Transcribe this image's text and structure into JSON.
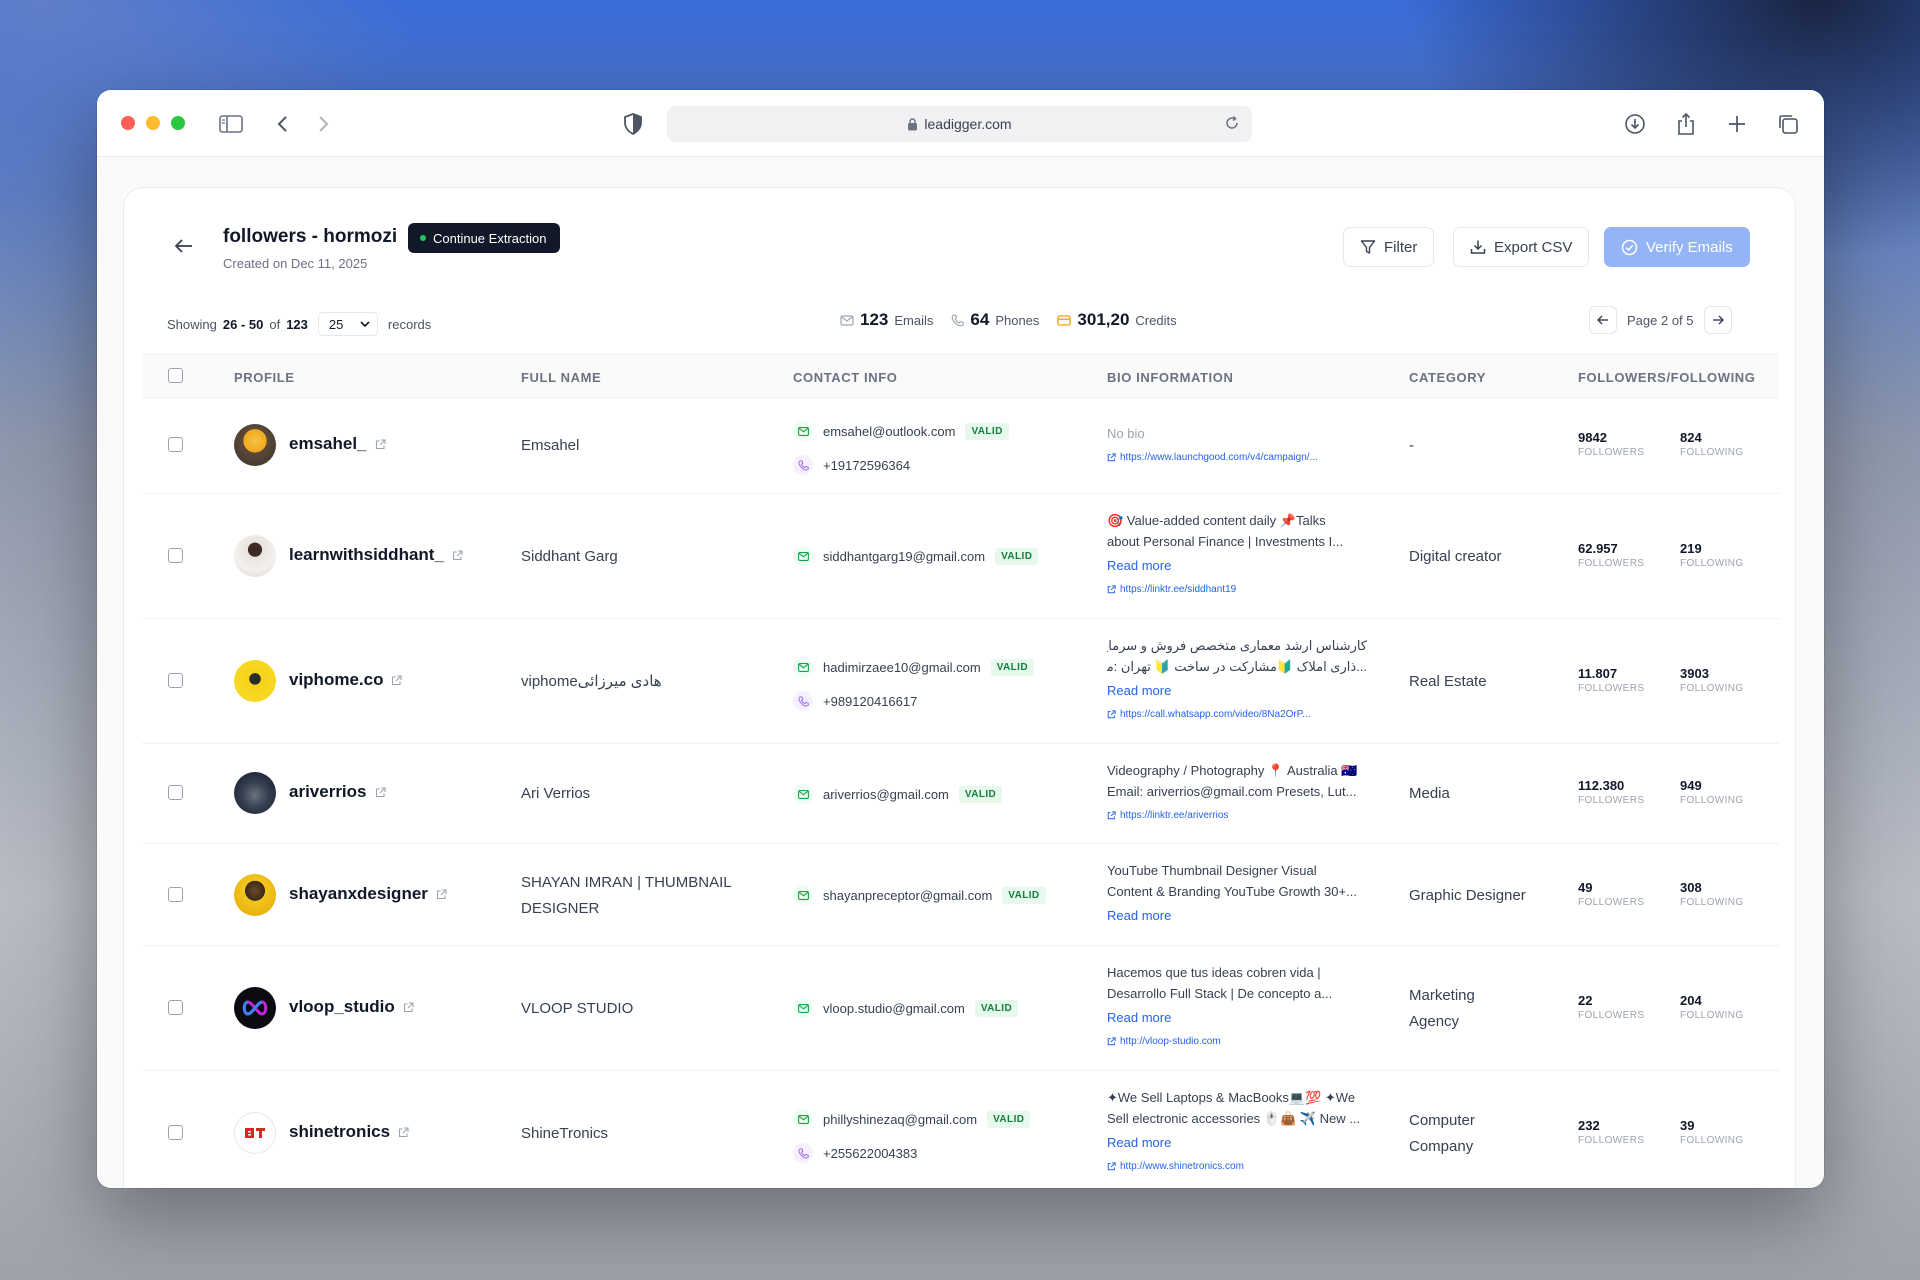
{
  "browser": {
    "url": "leadigger.com"
  },
  "header": {
    "title": "followers - hormozi",
    "continue_label": "Continue Extraction",
    "created": "Created on Dec 11, 2025",
    "filter_label": "Filter",
    "export_label": "Export CSV",
    "verify_label": "Verify Emails"
  },
  "toolbar": {
    "showing_prefix": "Showing",
    "range": "26 - 50",
    "of_label": "of",
    "total": "123",
    "per_page": "25",
    "records_label": "records",
    "emails_count": "123",
    "emails_label": "Emails",
    "phones_count": "64",
    "phones_label": "Phones",
    "credits_count": "301,20",
    "credits_label": "Credits",
    "page_label": "Page 2 of 5"
  },
  "columns": {
    "profile": "PROFILE",
    "full_name": "FULL NAME",
    "contact": "CONTACT INFO",
    "bio": "BIO INFORMATION",
    "category": "CATEGORY",
    "ff": "FOLLOWERS/FOLLOWING"
  },
  "labels": {
    "valid": "VALID",
    "followers": "FOLLOWERS",
    "following": "FOLLOWING",
    "read_more": "Read more",
    "no_bio": "No bio"
  },
  "rows": [
    {
      "username": "emsahel_",
      "full_name": "Emsahel",
      "email": "emsahel@outlook.com",
      "phone": "+19172596364",
      "bio1": "No bio",
      "bio2": "",
      "bio_link": "https://www.launchgood.com/v4/campaign/...",
      "category": "-",
      "category2": "",
      "followers": "9842",
      "following": "824"
    },
    {
      "username": "learnwithsiddhant_",
      "full_name": "Siddhant Garg",
      "email": "siddhantgarg19@gmail.com",
      "phone": "",
      "bio1": "🎯 Value-added content daily 📌Talks",
      "bio2": "about Personal Finance | Investments I...",
      "bio_link": "https://linktr.ee/siddhant19",
      "category": "Digital creator",
      "category2": "",
      "followers": "62.957",
      "following": "219"
    },
    {
      "username": "viphome.co",
      "full_name": "viphomeهادی میرزائی",
      "email": "hadimirzaee10@gmail.com",
      "phone": "+989120416617",
      "bio1": "کارشناس ارشد معماری متخصص فروش و سرمایه",
      "bio2": "...ذاری املاک 🔰مشارکت در ساخت 🔰 تهران :منطقه",
      "bio_link": "https://call.whatsapp.com/video/8Na2OrP...",
      "category": "Real Estate",
      "category2": "",
      "followers": "11.807",
      "following": "3903"
    },
    {
      "username": "ariverrios",
      "full_name": "Ari Verrios",
      "email": "ariverrios@gmail.com",
      "phone": "",
      "bio1": "Videography / Photography 📍 Australia 🇦🇺",
      "bio2": "Email: ariverrios@gmail.com Presets, Lut...",
      "bio_link": "https://linktr.ee/ariverrios",
      "category": "Media",
      "category2": "",
      "followers": "112.380",
      "following": "949"
    },
    {
      "username": "shayanxdesigner",
      "full_name": "SHAYAN IMRAN | THUMBNAIL DESIGNER",
      "email": "shayanpreceptor@gmail.com",
      "phone": "",
      "bio1": "YouTube Thumbnail Designer Visual",
      "bio2": "Content & Branding YouTube Growth 30+...",
      "bio_link": "",
      "category": "Graphic Designer",
      "category2": "",
      "followers": "49",
      "following": "308"
    },
    {
      "username": "vloop_studio",
      "full_name": "VLOOP STUDIO",
      "email": "vloop.studio@gmail.com",
      "phone": "",
      "bio1": "Hacemos que tus ideas cobren vida |",
      "bio2": "Desarrollo Full Stack | De concepto a...",
      "bio_link": "http://vloop-studio.com",
      "category": "Marketing",
      "category2": "Agency",
      "followers": "22",
      "following": "204"
    },
    {
      "username": "shinetronics",
      "full_name": "ShineTronics",
      "email": "phillyshinezaq@gmail.com",
      "phone": "+255622004383",
      "bio1": "✦We Sell Laptops & MacBooks💻💯 ✦We",
      "bio2": "Sell electronic accessories 🖱️👜 ✈️ New ...",
      "bio_link": "http://www.shinetronics.com",
      "category": "Computer",
      "category2": "Company",
      "followers": "232",
      "following": "39"
    }
  ]
}
